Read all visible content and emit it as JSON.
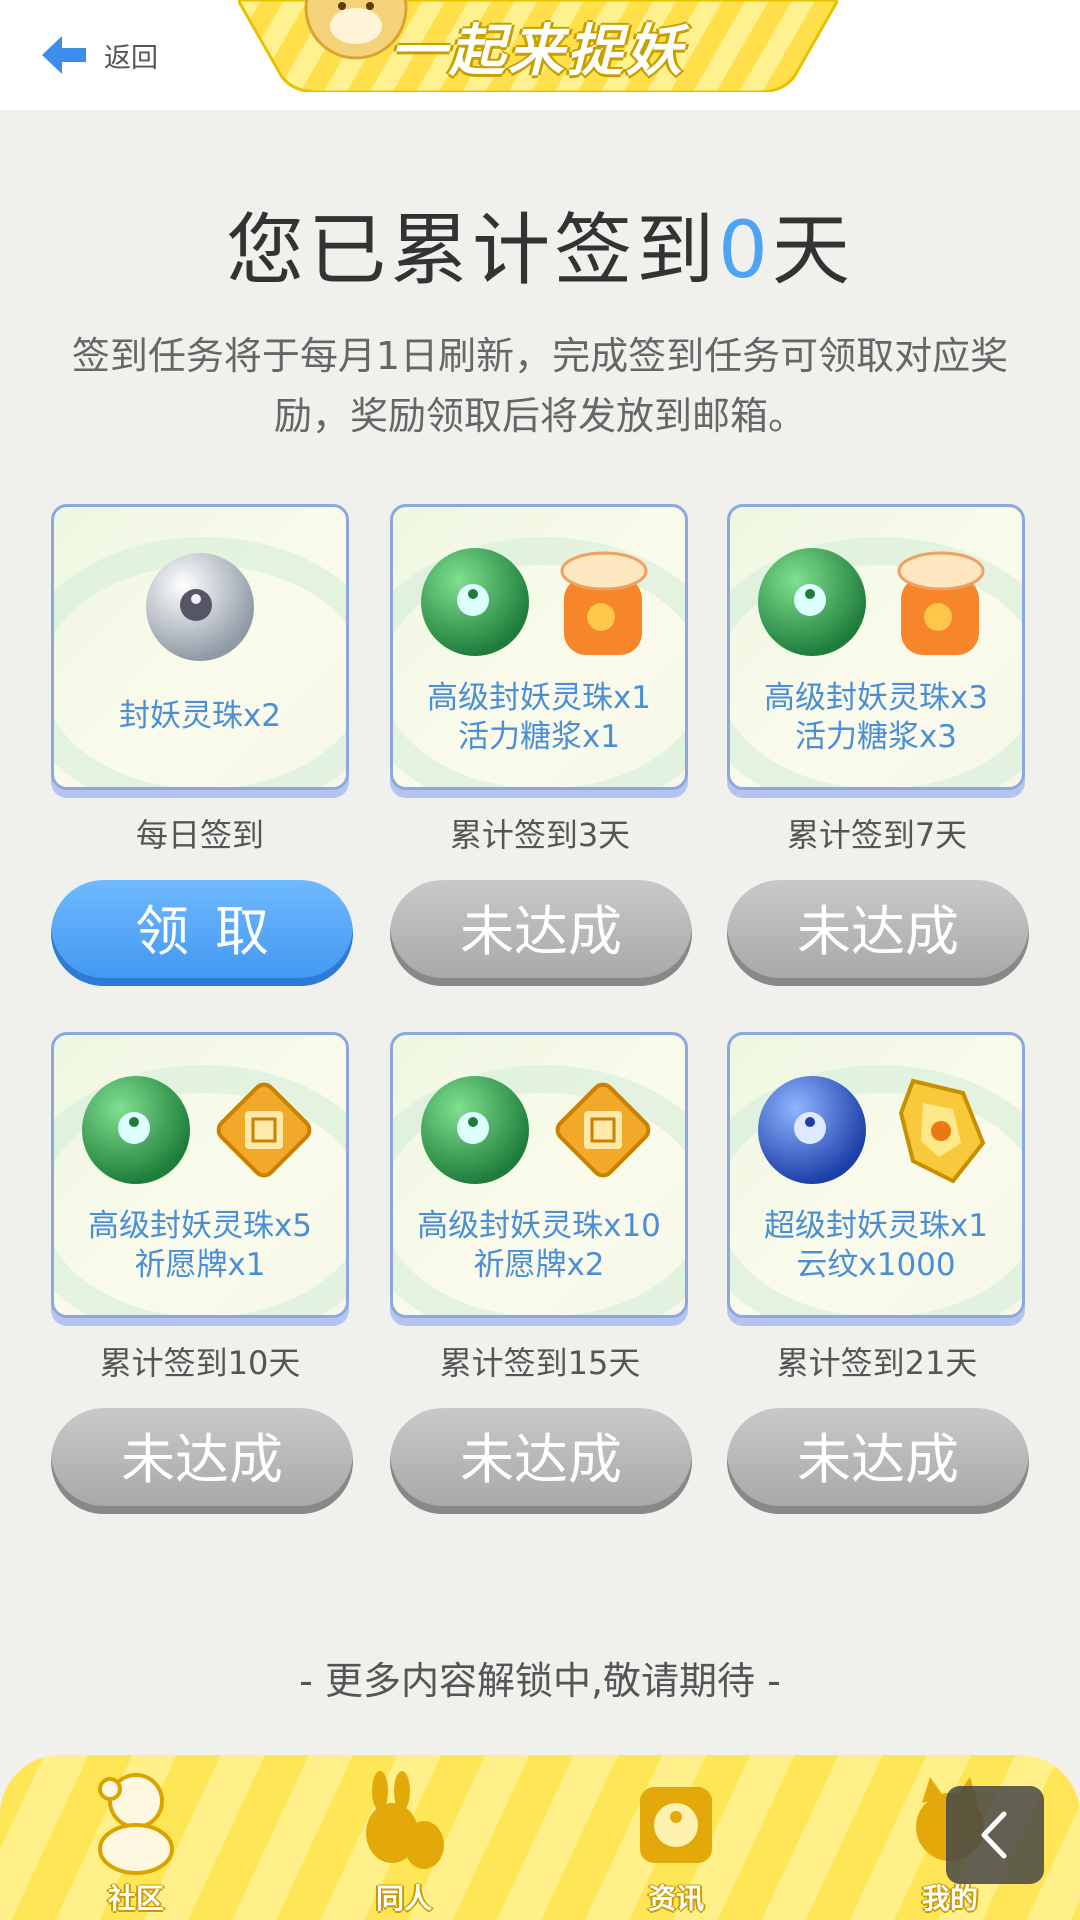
{
  "header": {
    "back_label": "返回",
    "banner_title": "一起来捉妖"
  },
  "signin": {
    "title_prefix": "您已累计签到",
    "days": "0",
    "title_suffix": "天",
    "description": "签到任务将于每月1日刷新，完成签到任务可领取对应奖励，奖励领取后将发放到邮箱。"
  },
  "rewards": [
    {
      "line1": "封妖灵珠x2",
      "line2": "",
      "condition": "每日签到",
      "button": "领取",
      "status": "claimable",
      "icons": [
        "white-yinyang-orb-icon"
      ]
    },
    {
      "line1": "高级封妖灵珠x1",
      "line2": "活力糖浆x1",
      "condition": "累计签到3天",
      "button": "未达成",
      "status": "locked",
      "icons": [
        "green-yinyang-orb-icon",
        "syrup-jar-icon"
      ]
    },
    {
      "line1": "高级封妖灵珠x3",
      "line2": "活力糖浆x3",
      "condition": "累计签到7天",
      "button": "未达成",
      "status": "locked",
      "icons": [
        "green-yinyang-orb-icon",
        "syrup-jar-icon"
      ]
    },
    {
      "line1": "高级封妖灵珠x5",
      "line2": "祈愿牌x1",
      "condition": "累计签到10天",
      "button": "未达成",
      "status": "locked",
      "icons": [
        "green-yinyang-orb-icon",
        "wish-plaque-icon"
      ]
    },
    {
      "line1": "高级封妖灵珠x10",
      "line2": "祈愿牌x2",
      "condition": "累计签到15天",
      "button": "未达成",
      "status": "locked",
      "icons": [
        "green-yinyang-orb-icon",
        "wish-plaque-icon"
      ]
    },
    {
      "line1": "超级封妖灵珠x1",
      "line2": "云纹x1000",
      "condition": "累计签到21天",
      "button": "未达成",
      "status": "locked",
      "icons": [
        "blue-yinyang-orb-icon",
        "golden-crystal-icon"
      ]
    }
  ],
  "footer_note": "- 更多内容解锁中,敬请期待 -",
  "tabs": [
    {
      "label": "社区",
      "icon": "community-icon"
    },
    {
      "label": "同人",
      "icon": "fan-art-icon"
    },
    {
      "label": "资讯",
      "icon": "news-icon"
    },
    {
      "label": "我的",
      "icon": "profile-icon"
    }
  ],
  "colors": {
    "accent_blue": "#4da3f5",
    "label_blue": "#4a8fd6",
    "banner_yellow": "#ffe14a",
    "locked_gray": "#a6a6a6"
  }
}
